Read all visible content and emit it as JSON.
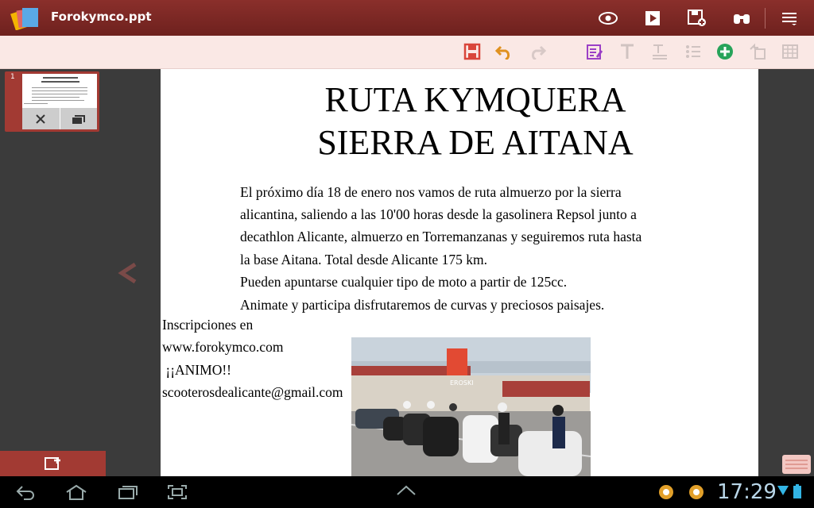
{
  "app": {
    "doc_title": "Forokymco.ppt"
  },
  "colors": {
    "titlebar": "#7c2824",
    "toolbar": "#fae8e5",
    "accent": "#a23a33",
    "canvas": "#3b3b3b"
  },
  "titlebar_icons": [
    "view-icon",
    "play-icon",
    "save-as-icon",
    "find-icon",
    "menu-icon"
  ],
  "toolbar_icons": [
    "save-icon",
    "undo-icon",
    "redo-icon",
    "edit-notes-icon",
    "text-icon",
    "text-format-icon",
    "list-icon",
    "add-icon",
    "arrange-icon",
    "table-icon"
  ],
  "thumbnails": [
    {
      "number": "1"
    }
  ],
  "slide": {
    "title_line1": "RUTA KYMQUERA",
    "title_line2": "SIERRA DE AITANA",
    "body": [
      "El próximo día 18 de enero nos vamos de ruta almuerzo por la sierra",
      "alicantina, saliendo a las 10'00 horas desde la gasolinera Repsol junto a",
      "decathlon Alicante, almuerzo en Torremanzanas y seguiremos ruta hasta",
      "la base Aitana. Total desde Alicante 175 km.",
      "Pueden apuntarse cualquier tipo de moto a partir de 125cc.",
      "Animate y participa disfrutaremos de curvas y preciosos paisajes."
    ],
    "left_block": [
      "Inscripciones en",
      "www.forokymco.com",
      " ¡¡ANIMO!!",
      "scooterosdealicante@gmail.com"
    ],
    "photo_sign": "EROSKI"
  },
  "status": {
    "time": "17:29"
  }
}
